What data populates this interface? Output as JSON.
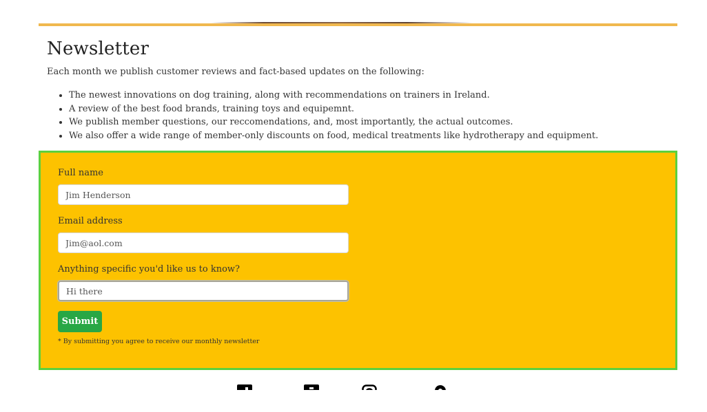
{
  "newsletter": {
    "title": "Newsletter",
    "intro": "Each month we publish customer reviews and fact-based updates on the following:",
    "bullets": [
      "The newest innovations on dog training, along with recommendations on trainers in Ireland.",
      "A review of the best food brands, training toys and equipemnt.",
      "We publish member questions, our reccomendations, and, most importantly, the actual outcomes.",
      "We also offer a wide range of member-only discounts on food, medical treatments like hydrotherapy and equipment."
    ]
  },
  "form": {
    "name_label": "Full name",
    "name_value": "Jim Henderson",
    "email_label": "Email address",
    "email_value": "Jim@aol.com",
    "message_label": "Anything specific you'd like us to know?",
    "message_value": "Hi there",
    "submit_label": "Submit",
    "fineprint": "* By submitting you agree to receive our monthly newsletter"
  },
  "social": {
    "icons": [
      "facebook-icon",
      "twitter-icon",
      "instagram-icon",
      "tripadvisor-icon"
    ]
  },
  "colors": {
    "panel_bg": "#fdc200",
    "panel_border": "#5bd03f",
    "accent_border": "#f0b84e",
    "submit_bg": "#28a745"
  }
}
